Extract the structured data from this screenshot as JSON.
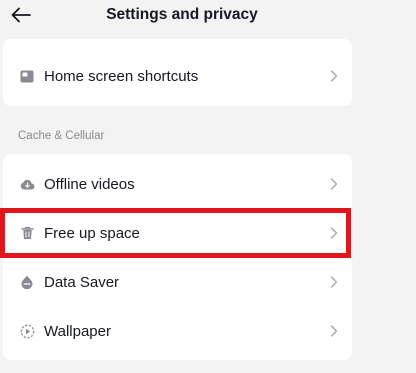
{
  "header": {
    "title": "Settings and privacy",
    "back_icon": "arrow-left-icon"
  },
  "sections": [
    {
      "label": "",
      "items": [
        {
          "label": "Home screen shortcuts",
          "icon": "home-shortcut-icon"
        }
      ]
    },
    {
      "label": "Cache & Cellular",
      "items": [
        {
          "label": "Offline videos",
          "icon": "cloud-download-icon"
        },
        {
          "label": "Free up space",
          "icon": "trash-icon"
        },
        {
          "label": "Data Saver",
          "icon": "data-saver-icon"
        },
        {
          "label": "Wallpaper",
          "icon": "wallpaper-icon"
        }
      ]
    }
  ],
  "highlight": {
    "target": "Free up space",
    "color": "#e1161c"
  },
  "colors": {
    "background": "#f3f3f3",
    "card": "#ffffff",
    "text": "#161823",
    "muted": "#8a8b91",
    "icon": "#8a8b91",
    "chevron": "#a7a8ad"
  }
}
